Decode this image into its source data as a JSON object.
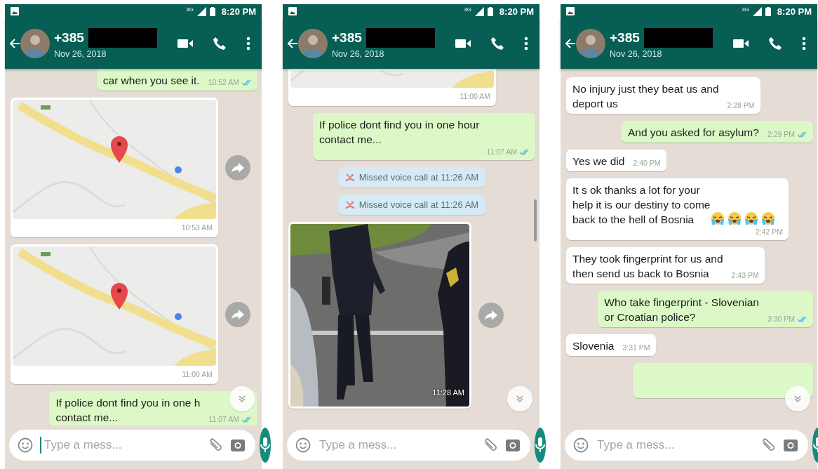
{
  "phones": [
    {
      "status_bar": {
        "network": "3G",
        "time": "8:20 PM"
      },
      "header": {
        "contact": "+385",
        "subtitle": "Nov 26, 2018"
      },
      "messages": [
        {
          "kind": "text",
          "outgoing": true,
          "cut": true,
          "text": "car when you see it.",
          "time": "10:52 AM",
          "read": true
        },
        {
          "kind": "map",
          "outgoing": false,
          "cut": false,
          "time": "10:53 AM",
          "forward": true
        },
        {
          "kind": "map",
          "outgoing": false,
          "cut": false,
          "time": "11:00 AM",
          "forward": true
        },
        {
          "kind": "text",
          "outgoing": true,
          "cut": false,
          "text": "If police dont find you in one h\ncontact me...",
          "time": "11:07 AM",
          "read": true
        }
      ],
      "scroll_down": true,
      "composer": {
        "placeholder": "Type a mess...",
        "focused": true
      }
    },
    {
      "status_bar": {
        "network": "3G",
        "time": "8:20 PM"
      },
      "header": {
        "contact": "+385",
        "subtitle": "Nov 26, 2018"
      },
      "messages": [
        {
          "kind": "map",
          "outgoing": false,
          "cut": true,
          "time": "11:00 AM",
          "forward": false
        },
        {
          "kind": "text",
          "outgoing": true,
          "cut": false,
          "text": "If police dont find you in one hour\ncontact me...",
          "time": "11:07 AM",
          "read": true
        },
        {
          "kind": "missed_call",
          "text": "Missed voice call at 11:26 AM"
        },
        {
          "kind": "missed_call",
          "text": "Missed voice call at 11:26 AM"
        },
        {
          "outgoing": false,
          "time": "11:28 AM",
          "forward": true
        }
      ],
      "scroll_down": true,
      "scrollbar": true,
      "composer": {
        "placeholder": "Type a mess..."
      }
    },
    {
      "status_bar": {
        "network": "3G",
        "time": "8:20 PM"
      },
      "header": {
        "contact": "+385",
        "subtitle": "Nov 26, 2018"
      },
      "messages": [
        {
          "kind": "text",
          "outgoing": false,
          "cut": false,
          "text": "No injury just they beat us and\ndeport us",
          "time": "2:28 PM"
        },
        {
          "kind": "text",
          "outgoing": true,
          "cut": false,
          "text": "And you asked for asylum?",
          "time": "2:29 PM",
          "read": true
        },
        {
          "kind": "text",
          "outgoing": false,
          "cut": false,
          "text": "Yes we did",
          "time": "2:40 PM"
        },
        {
          "kind": "text",
          "outgoing": false,
          "cut": false,
          "text": "It s ok thanks a lot for your\nhelp it is our destiny to come\nback to the hell of Bosnia",
          "emojis": [
            {
              "kind": "crying"
            },
            {
              "kind": "crying"
            },
            {
              "kind": "crying"
            },
            {
              "kind": "crying"
            }
          ],
          "time": "2:42 PM"
        },
        {
          "kind": "text",
          "outgoing": false,
          "cut": false,
          "text": "They took fingerprint for us and\nthen send us back to Bosnia",
          "time": "2:43 PM"
        },
        {
          "kind": "text",
          "outgoing": true,
          "cut": false,
          "text": "Who take fingerprint - Slovenian\nor Croatian police?",
          "time": "3:30 PM",
          "read": true
        },
        {
          "kind": "text",
          "outgoing": false,
          "cut": false,
          "text": "Slovenia",
          "time": "3:31 PM"
        },
        {
          "kind": "covered",
          "outgoing": true
        }
      ],
      "scroll_down": true,
      "composer": {
        "placeholder": "Type a mess..."
      }
    }
  ]
}
